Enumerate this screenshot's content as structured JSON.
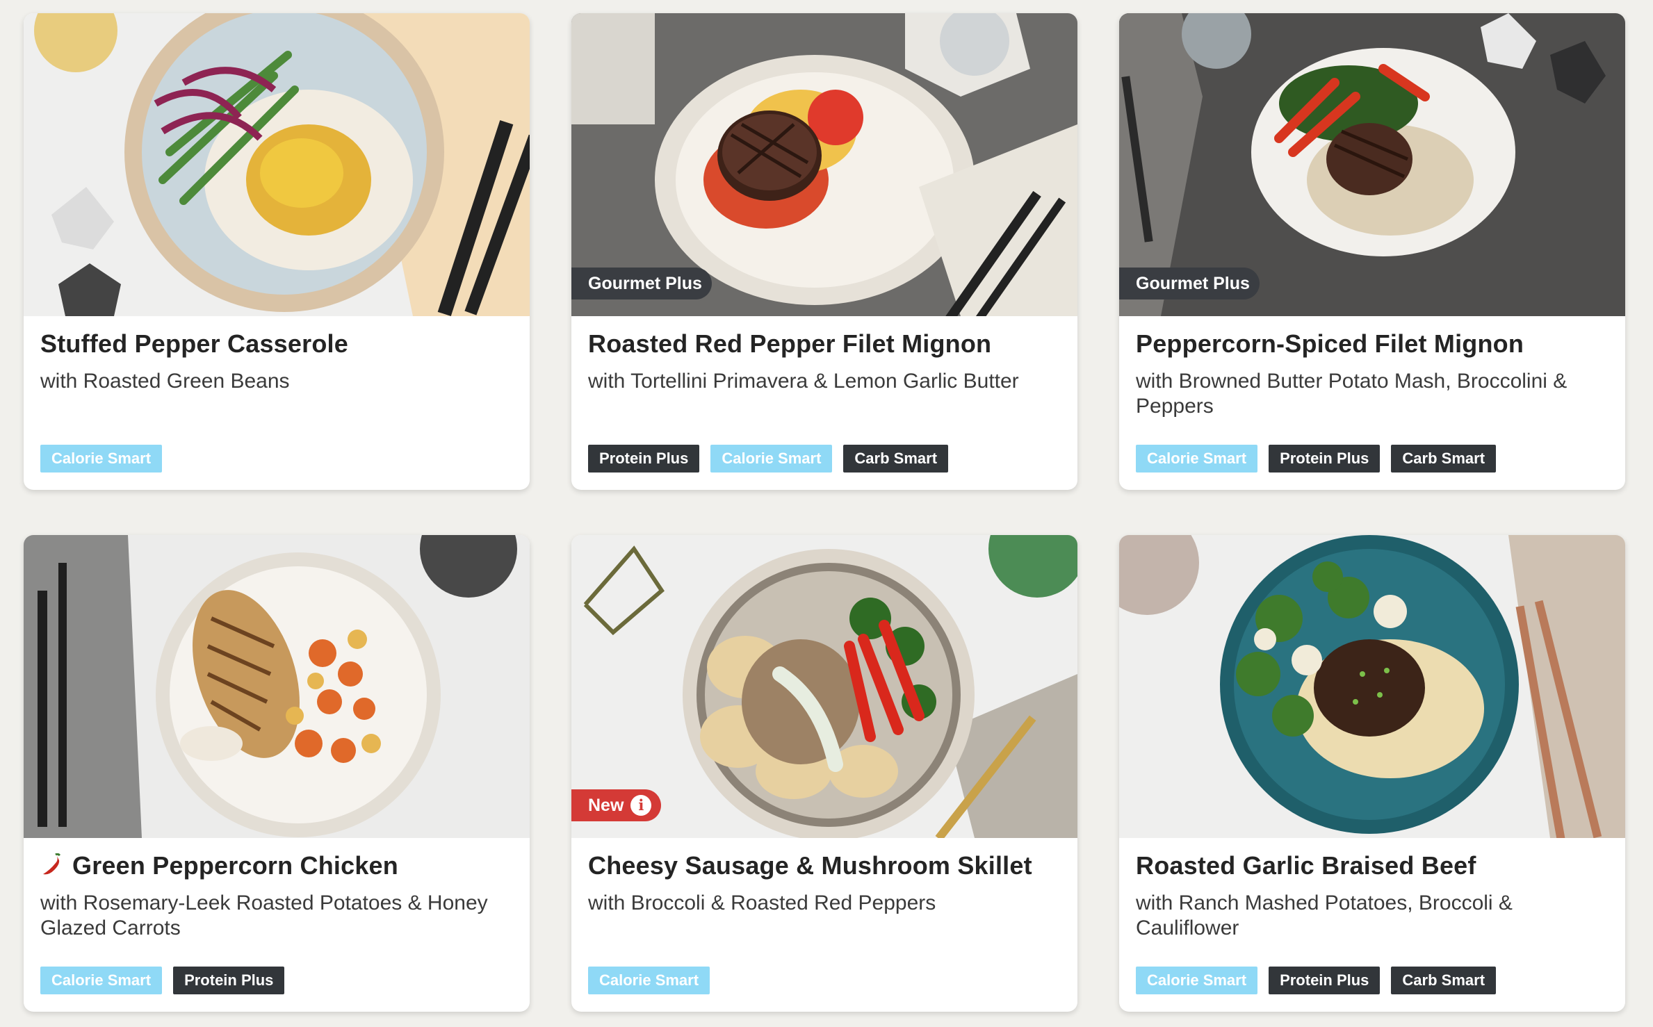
{
  "cards": [
    {
      "title": "Stuffed Pepper Casserole",
      "subtitle": "with Roasted Green Beans",
      "ribbon": null,
      "spicy": false,
      "tags": [
        "Calorie Smart"
      ]
    },
    {
      "title": "Roasted Red Pepper Filet Mignon",
      "subtitle": "with Tortellini Primavera & Lemon Garlic Butter",
      "ribbon": "Gourmet Plus",
      "spicy": false,
      "tags": [
        "Protein Plus",
        "Calorie Smart",
        "Carb Smart"
      ]
    },
    {
      "title": "Peppercorn-Spiced Filet Mignon",
      "subtitle": "with Browned Butter Potato Mash, Broccolini & Peppers",
      "ribbon": "Gourmet Plus",
      "spicy": false,
      "tags": [
        "Calorie Smart",
        "Protein Plus",
        "Carb Smart"
      ]
    },
    {
      "title": "Green Peppercorn Chicken",
      "subtitle": "with Rosemary-Leek Roasted Potatoes & Honey Glazed Carrots",
      "ribbon": null,
      "spicy": true,
      "tags": [
        "Calorie Smart",
        "Protein Plus"
      ]
    },
    {
      "title": "Cheesy Sausage & Mushroom Skillet",
      "subtitle": "with Broccoli & Roasted Red Peppers",
      "ribbon": "New",
      "spicy": false,
      "tags": [
        "Calorie Smart"
      ]
    },
    {
      "title": "Roasted Garlic Braised Beef",
      "subtitle": "with Ranch Mashed Potatoes, Broccoli & Cauliflower",
      "ribbon": null,
      "spicy": false,
      "tags": [
        "Calorie Smart",
        "Protein Plus",
        "Carb Smart"
      ]
    }
  ],
  "colors": {
    "calorie_smart": "#8fd9f6",
    "dark_tag": "#32363a",
    "gourmet_ribbon": "#3a3d42",
    "new_ribbon": "#d43a36",
    "page_background": "#f1f0ec"
  },
  "icons": {
    "spicy": "chili-pepper-icon",
    "new_info": "info-icon"
  }
}
